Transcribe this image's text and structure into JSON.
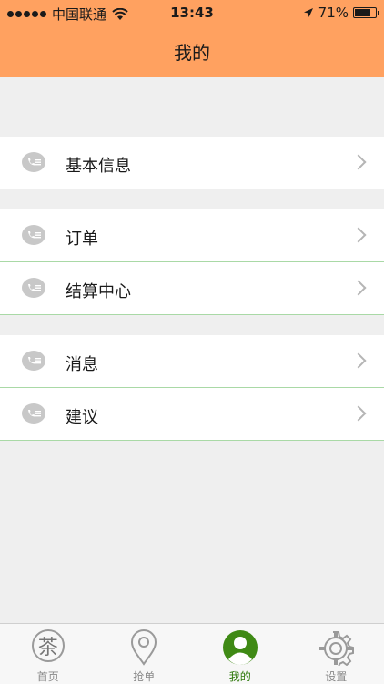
{
  "status_bar": {
    "carrier": "中国联通",
    "time": "13:43",
    "battery": "71%"
  },
  "header": {
    "title": "我的"
  },
  "groups": [
    {
      "items": [
        {
          "label": "基本信息"
        }
      ]
    },
    {
      "items": [
        {
          "label": "订单"
        },
        {
          "label": "结算中心"
        }
      ]
    },
    {
      "items": [
        {
          "label": "消息"
        },
        {
          "label": "建议"
        }
      ]
    }
  ],
  "tabbar": {
    "tabs": [
      {
        "label": "首页",
        "icon": "tea-icon",
        "glyph": "茶"
      },
      {
        "label": "抢单",
        "icon": "location-pin-icon"
      },
      {
        "label": "我的",
        "icon": "profile-icon",
        "active": true
      },
      {
        "label": "设置",
        "icon": "gear-icon"
      }
    ]
  },
  "colors": {
    "header": "#ffa160",
    "active_tab": "#2f7a0c",
    "row_divider": "#a9d9a6"
  }
}
